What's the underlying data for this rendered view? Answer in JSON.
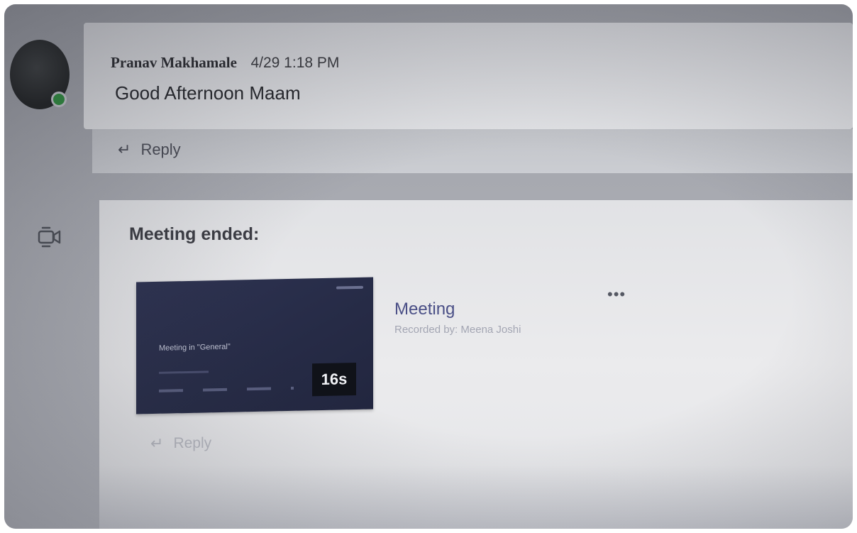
{
  "message": {
    "sender": "Pranav Makhamale",
    "timestamp": "4/29 1:18 PM",
    "text": "Good Afternoon Maam",
    "reply_label": "Reply"
  },
  "meeting": {
    "status": "Meeting ended:",
    "thumbnail_title": "Meeting in \"General\"",
    "duration": "16s",
    "title": "Meeting",
    "recorded_by": "Recorded by: Meena Joshi",
    "more_label": "•••",
    "reply_label": "Reply"
  },
  "icons": {
    "reply": "reply-arrow-icon",
    "camera": "video-camera-icon",
    "presence": "presence-available-icon"
  },
  "colors": {
    "presence": "#2f8f3e",
    "thumbnail": "#2a2f4c",
    "meeting_title": "#4a4f86"
  }
}
